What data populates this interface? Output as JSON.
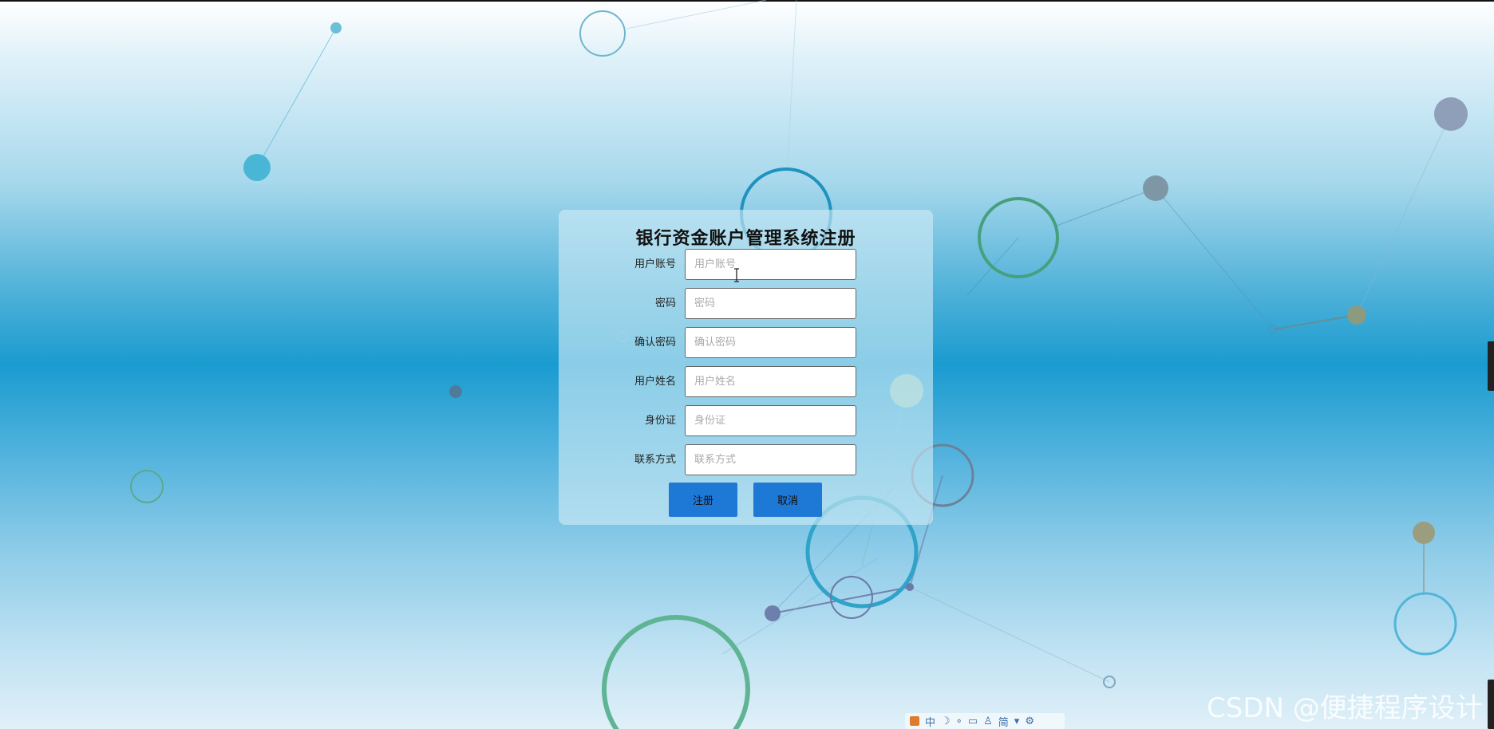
{
  "form": {
    "title": "银行资金账户管理系统注册",
    "fields": [
      {
        "label": "用户账号",
        "placeholder": "用户账号",
        "value": ""
      },
      {
        "label": "密码",
        "placeholder": "密码",
        "value": ""
      },
      {
        "label": "确认密码",
        "placeholder": "确认密码",
        "value": ""
      },
      {
        "label": "用户姓名",
        "placeholder": "用户姓名",
        "value": ""
      },
      {
        "label": "身份证",
        "placeholder": "身份证",
        "value": ""
      },
      {
        "label": "联系方式",
        "placeholder": "联系方式",
        "value": ""
      }
    ],
    "buttons": {
      "register": "注册",
      "cancel": "取消"
    }
  },
  "watermark": "CSDN @便捷程序设计",
  "ime_toolbar": {
    "mode": "中",
    "items": [
      "moon-icon",
      "dots-icon",
      "keyboard-icon",
      "person-icon",
      "simplified-icon",
      "skin-icon",
      "gear-icon"
    ],
    "simplified_label": "简"
  },
  "colors": {
    "button_bg": "#1e78d6",
    "card_bg": "rgba(208,235,246,0.62)"
  }
}
